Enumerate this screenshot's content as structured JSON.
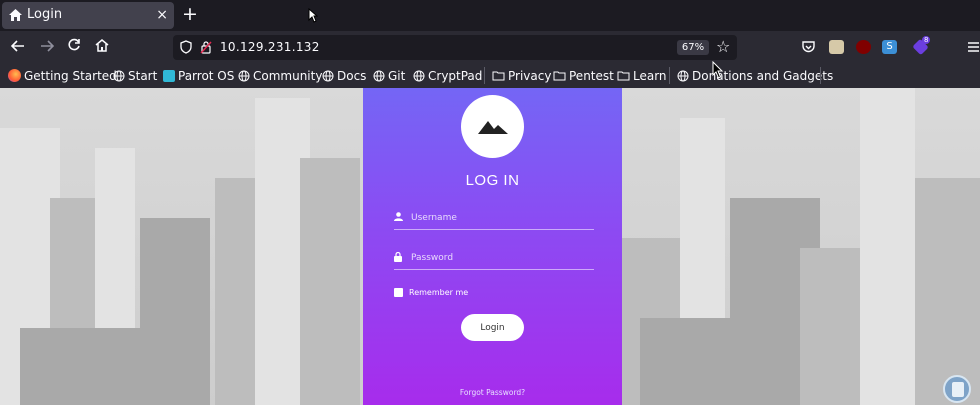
{
  "browser": {
    "tab_title": "Login",
    "tab_close": "×",
    "new_tab": "+",
    "url": "10.129.231.132",
    "zoom": "67%",
    "nav_icons": [
      "back-icon",
      "forward-icon",
      "reload-icon",
      "home-icon"
    ],
    "extensions": [
      "pocket-icon",
      "extension-icon",
      "ublock-icon",
      "extension-s-icon",
      "extension-badge-icon",
      "app-menu-icon"
    ],
    "extension_badge": "8"
  },
  "bookmarks": [
    {
      "label": "Getting Started",
      "icon": "firefox-icon"
    },
    {
      "label": "Start",
      "icon": "globe-icon"
    },
    {
      "label": "Parrot OS",
      "icon": "parrot-icon"
    },
    {
      "label": "Community",
      "icon": "globe-icon"
    },
    {
      "label": "Docs",
      "icon": "globe-icon"
    },
    {
      "label": "Git",
      "icon": "globe-icon"
    },
    {
      "label": "CryptPad",
      "icon": "globe-icon"
    },
    {
      "label": "Privacy",
      "icon": "folder-icon"
    },
    {
      "label": "Pentest",
      "icon": "folder-icon"
    },
    {
      "label": "Learn",
      "icon": "folder-icon"
    },
    {
      "label": "Donations and Gadgets",
      "icon": "globe-icon"
    }
  ],
  "login": {
    "title": "LOG IN",
    "username_placeholder": "Username",
    "password_placeholder": "Password",
    "remember_label": "Remember me",
    "login_button": "Login",
    "forgot_link": "Forgot Password?"
  },
  "colors": {
    "card_top": "#7466f5",
    "card_bottom": "#a72cec",
    "chrome_bg": "#2b2a33",
    "tabstrip_bg": "#1c1b22"
  }
}
